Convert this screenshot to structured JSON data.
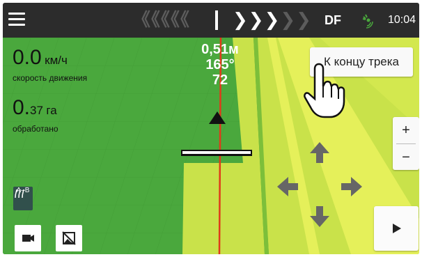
{
  "topbar": {
    "guidance_left": "《《《《《",
    "guidance_right_active": "❯❯❯",
    "guidance_right_dim": "❯❯",
    "receiver": "DF",
    "gps_icon": "satellite-icon",
    "time": "10:04"
  },
  "stats": {
    "speed_value": "0.0",
    "speed_unit": "км/ч",
    "speed_label": "скорость движения",
    "area_value": "0.",
    "area_value_small": "37",
    "area_unit": "га",
    "area_label": "обработано"
  },
  "hud": {
    "offset": "0,51м",
    "heading": "165°",
    "line_number": "72"
  },
  "buttons": {
    "to_track_end": "К концу трека",
    "zoom_in": "+",
    "zoom_out": "−",
    "ab_mode": "A–B"
  },
  "colors": {
    "field": "#4aa83d",
    "processed": "#c9e24a",
    "processed_bright": "#e5f05a",
    "guide_line": "#e03a1a",
    "topbar": "#2c2c2c"
  }
}
